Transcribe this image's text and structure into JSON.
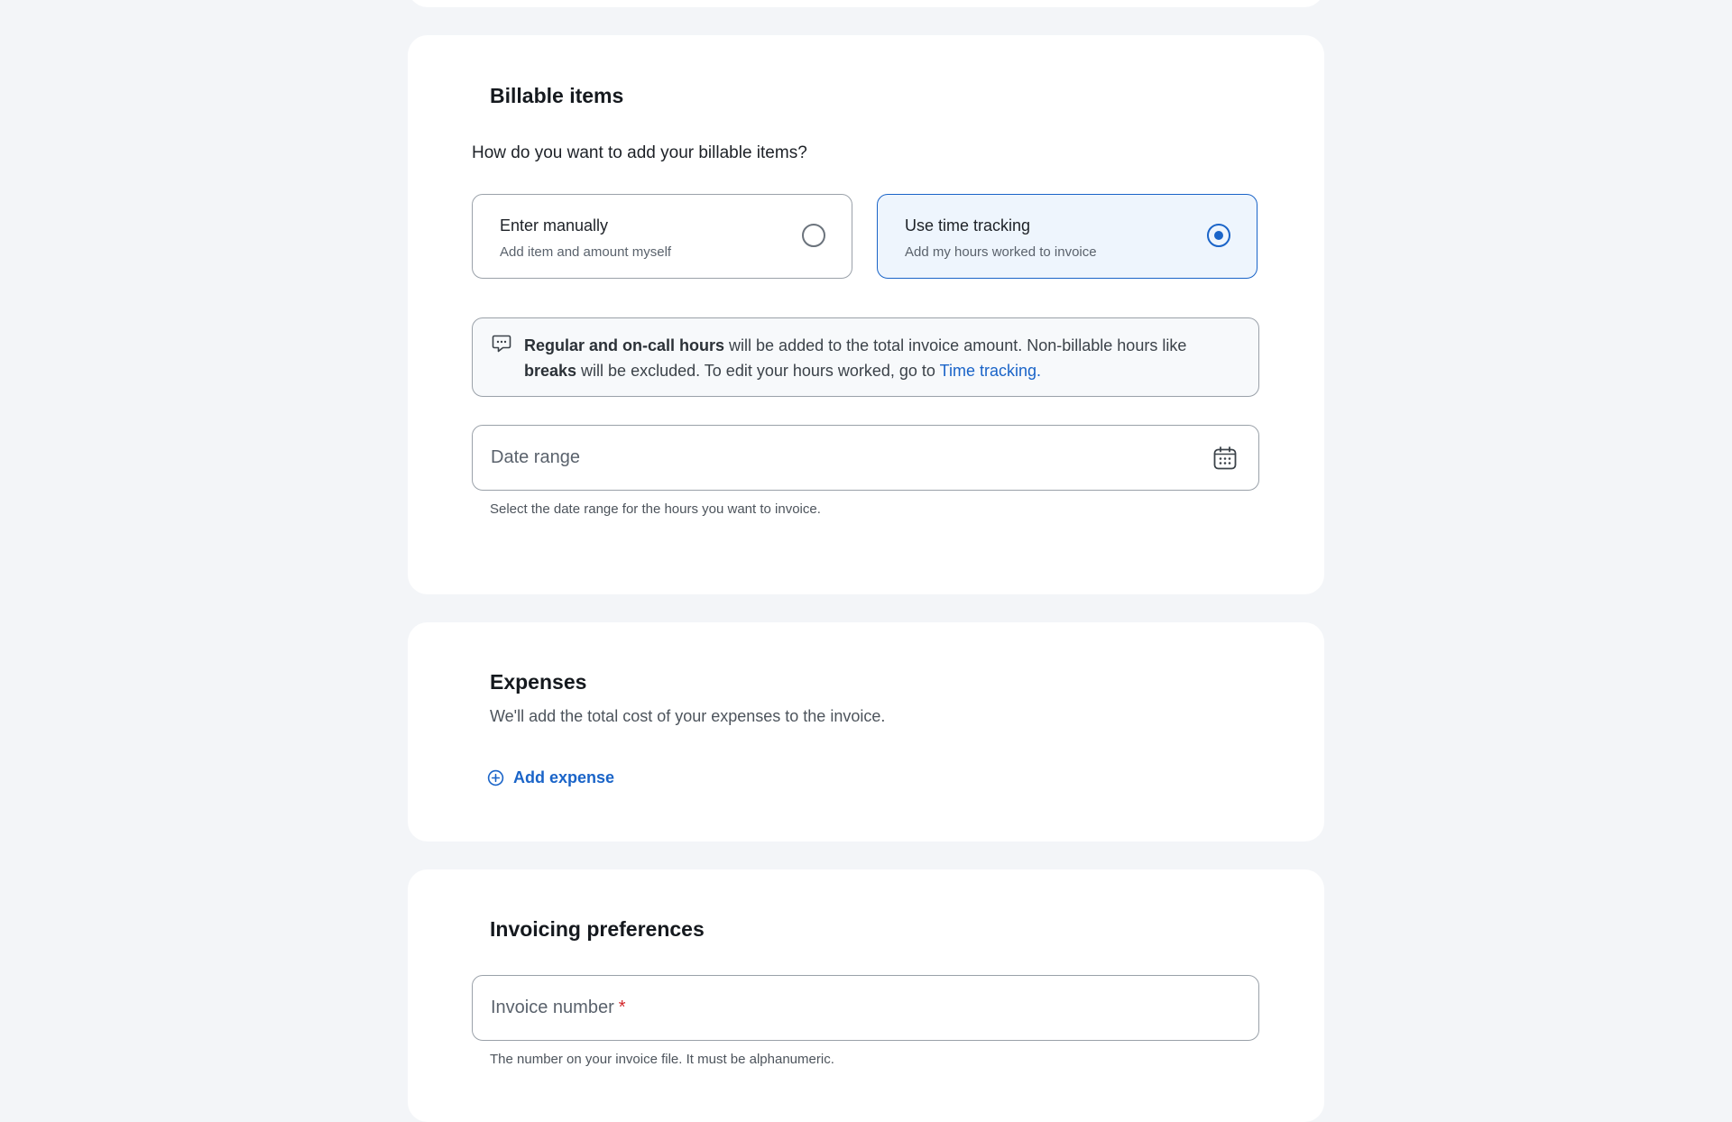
{
  "billable": {
    "title": "Billable items",
    "question": "How do you want to add your billable items?",
    "options": [
      {
        "title": "Enter manually",
        "desc": "Add item and amount myself",
        "selected": false
      },
      {
        "title": "Use time tracking",
        "desc": "Add my hours worked to invoice",
        "selected": true
      }
    ],
    "info": {
      "bold1": "Regular and on-call hours",
      "text1": " will be added to the total invoice amount. Non-billable hours like ",
      "bold2": "breaks",
      "text2": " will be excluded. To edit your hours worked, go to ",
      "link": "Time tracking."
    },
    "date_range": {
      "label": "Date range",
      "helper": "Select the date range for the hours you want to invoice."
    }
  },
  "expenses": {
    "title": "Expenses",
    "subtitle": "We'll add the total cost of your expenses to the invoice.",
    "add_label": "Add expense"
  },
  "preferences": {
    "title": "Invoicing preferences",
    "invoice_number": {
      "label": "Invoice number",
      "required_mark": "*",
      "helper": "The number on your invoice file. It must be alphanumeric."
    }
  },
  "colors": {
    "accent": "#1a64c8",
    "background": "#f3f5f8",
    "required": "#d2262a"
  },
  "icons": {
    "info": "chat-bubble-icon",
    "date": "calendar-icon",
    "add": "plus-circle-icon"
  }
}
